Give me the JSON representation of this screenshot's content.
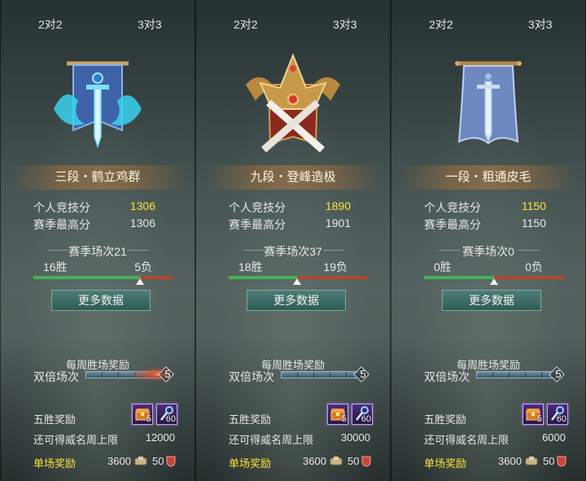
{
  "panels": [
    {
      "tabs": {
        "left": "2对2",
        "right": "3对3"
      },
      "emblem_icon": "dragon-banner-sword-emblem",
      "rank_title": "三段・鹤立鸡群",
      "stats": {
        "score_label": "个人竞技分",
        "score_value": "1306",
        "best_label": "赛季最高分",
        "best_value": "1306"
      },
      "season": {
        "label": "赛季场次21",
        "wins": "16胜",
        "losses": "5负",
        "win_ratio": 0.76
      },
      "more_button": "更多数据",
      "weekly": {
        "title": "每周胜场奖励",
        "double_label": "双倍场次",
        "double_count": "5",
        "glow": true
      },
      "rewards": {
        "five_win_label": "五胜奖励",
        "five_win_items": [
          {
            "icon": "treasure-chest-icon",
            "count": "5"
          },
          {
            "icon": "key-icon",
            "count": "60"
          }
        ],
        "fame_label": "还可得威名周上限",
        "fame_value": "12000",
        "single_label": "单场奖励",
        "single_coins": "3600",
        "single_honor": "50"
      }
    },
    {
      "tabs": {
        "left": "2对2",
        "right": "3对3"
      },
      "emblem_icon": "crown-crossed-swords-emblem",
      "rank_title": "九段・登峰造极",
      "stats": {
        "score_label": "个人竞技分",
        "score_value": "1890",
        "best_label": "赛季最高分",
        "best_value": "1901"
      },
      "season": {
        "label": "赛季场次37",
        "wins": "18胜",
        "losses": "19负",
        "win_ratio": 0.486
      },
      "more_button": "更多数据",
      "weekly": {
        "title": "每周胜场奖励",
        "double_label": "双倍场次",
        "double_count": "5",
        "glow": false
      },
      "rewards": {
        "five_win_label": "五胜奖励",
        "five_win_items": [
          {
            "icon": "treasure-chest-icon",
            "count": "5"
          },
          {
            "icon": "key-icon",
            "count": "60"
          }
        ],
        "fame_label": "还可得威名周上限",
        "fame_value": "30000",
        "single_label": "单场奖励",
        "single_coins": "3600",
        "single_honor": "50"
      }
    },
    {
      "tabs": {
        "left": "2对2",
        "right": "3对3"
      },
      "emblem_icon": "plain-banner-sword-emblem",
      "rank_title": "一段・粗通皮毛",
      "stats": {
        "score_label": "个人竞技分",
        "score_value": "1150",
        "best_label": "赛季最高分",
        "best_value": "1150"
      },
      "season": {
        "label": "赛季场次0",
        "wins": "0胜",
        "losses": "0负",
        "win_ratio": 0.5
      },
      "more_button": "更多数据",
      "weekly": {
        "title": "每周胜场奖励",
        "double_label": "双倍场次",
        "double_count": "5",
        "glow": false
      },
      "rewards": {
        "five_win_label": "五胜奖励",
        "five_win_items": [
          {
            "icon": "treasure-chest-icon",
            "count": "5"
          },
          {
            "icon": "key-icon",
            "count": "60"
          }
        ],
        "fame_label": "还可得威名周上限",
        "fame_value": "6000",
        "single_label": "单场奖励",
        "single_coins": "3600",
        "single_honor": "50"
      }
    }
  ],
  "colors": {
    "highlight": "#ffe23a",
    "win": "#47b05a",
    "loss": "#b0482e",
    "button": "#3a6a65"
  }
}
